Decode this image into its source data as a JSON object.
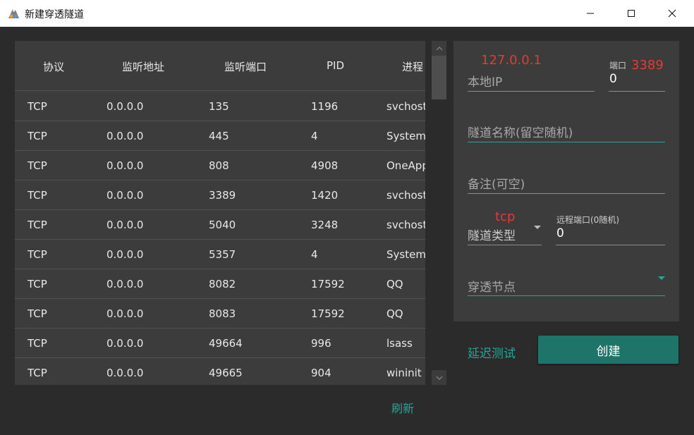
{
  "window": {
    "title": "新建穿透隧道"
  },
  "table": {
    "headers": [
      "协议",
      "监听地址",
      "监听端口",
      "PID",
      "进程"
    ],
    "rows": [
      [
        "TCP",
        "0.0.0.0",
        "135",
        "1196",
        "svchost"
      ],
      [
        "TCP",
        "0.0.0.0",
        "445",
        "4",
        "System"
      ],
      [
        "TCP",
        "0.0.0.0",
        "808",
        "4908",
        "OneApp"
      ],
      [
        "TCP",
        "0.0.0.0",
        "3389",
        "1420",
        "svchost"
      ],
      [
        "TCP",
        "0.0.0.0",
        "5040",
        "3248",
        "svchost"
      ],
      [
        "TCP",
        "0.0.0.0",
        "5357",
        "4",
        "System"
      ],
      [
        "TCP",
        "0.0.0.0",
        "8082",
        "17592",
        "QQ"
      ],
      [
        "TCP",
        "0.0.0.0",
        "8083",
        "17592",
        "QQ"
      ],
      [
        "TCP",
        "0.0.0.0",
        "49664",
        "996",
        "lsass"
      ],
      [
        "TCP",
        "0.0.0.0",
        "49665",
        "904",
        "wininit"
      ]
    ],
    "refresh_label": "刷新"
  },
  "form": {
    "local_ip": {
      "label": "本地IP",
      "value": "",
      "annotation": "127.0.0.1"
    },
    "port": {
      "label": "端口",
      "value": "0",
      "annotation": "3389"
    },
    "tunnel_name": {
      "placeholder": "隧道名称(留空随机)"
    },
    "remark": {
      "placeholder": "备注(可空)"
    },
    "tunnel_type": {
      "label": "隧道类型",
      "annotation": "tcp"
    },
    "remote_port": {
      "label": "远程端口(0随机)",
      "value": "0"
    },
    "node": {
      "placeholder": "穿透节点"
    },
    "latency_test_label": "延迟测试",
    "create_label": "创建"
  },
  "colors": {
    "accent": "#26a69a",
    "annotation": "#e53935",
    "button": "#1e7468",
    "panel": "#3c3c3c",
    "background": "#2b2b2b"
  }
}
